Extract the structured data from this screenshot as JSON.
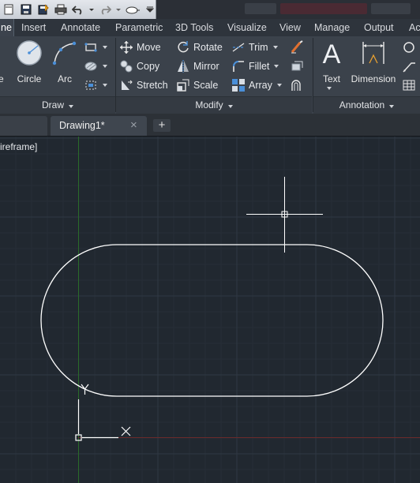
{
  "quick_access": {
    "icons": [
      "new-icon",
      "open-icon",
      "save-icon",
      "save-as-icon",
      "plot-icon",
      "undo-icon",
      "undo-dropdown-icon",
      "redo-icon",
      "redo-dropdown-icon",
      "workspace-icon",
      "customize-dropdown-icon"
    ]
  },
  "ribbon_tabs": [
    {
      "label": "ne",
      "active": true
    },
    {
      "label": "Insert"
    },
    {
      "label": "Annotate"
    },
    {
      "label": "Parametric"
    },
    {
      "label": "3D Tools"
    },
    {
      "label": "Visualize"
    },
    {
      "label": "View"
    },
    {
      "label": "Manage"
    },
    {
      "label": "Output"
    },
    {
      "label": "Ac"
    }
  ],
  "draw_panel": {
    "title": "Draw",
    "partial_label": "e",
    "circle_label": "Circle",
    "arc_label": "Arc"
  },
  "modify_panel": {
    "title": "Modify",
    "move": "Move",
    "rotate": "Rotate",
    "trim": "Trim",
    "copy": "Copy",
    "mirror": "Mirror",
    "fillet": "Fillet",
    "stretch": "Stretch",
    "scale": "Scale",
    "array": "Array"
  },
  "annotation_panel": {
    "title": "Annotation",
    "text_label": "Text",
    "dimension_label": "Dimension"
  },
  "document_tabs": {
    "active_tab": "Drawing1*",
    "close_symbol": "×",
    "new_tab_symbol": "+"
  },
  "viewport": {
    "visual_style_label": "ireframe]",
    "ucs_y": "Y",
    "ucs_x": "X"
  },
  "colors": {
    "canvas_bg": "#212830",
    "grid_major": "#2f3843",
    "grid_minor": "#262e37",
    "y_axis": "#2a6b2a",
    "x_axis": "#6b2a2a",
    "geometry": "#ffffff"
  }
}
